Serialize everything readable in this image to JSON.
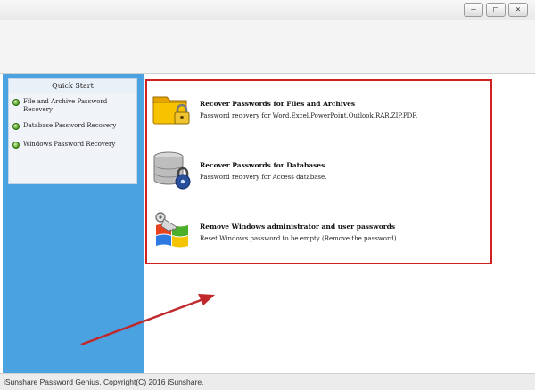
{
  "window": {
    "minimize_symbol": "–",
    "maximize_symbol": "□",
    "close_symbol": "×"
  },
  "sidebar": {
    "title": "Quick Start",
    "items": [
      {
        "label": "File and Archive Password Recovery",
        "icon": "green-bullet-icon"
      },
      {
        "label": "Database Password Recovery",
        "icon": "green-bullet-icon"
      },
      {
        "label": "Windows Password Recovery",
        "icon": "green-bullet-icon"
      }
    ]
  },
  "main": {
    "options": [
      {
        "title": "Recover Passwords for Files and Archives",
        "description": "Password recovery for Word,Excel,PowerPoint,Outlook,RAR,ZIP,PDF.",
        "icon": "locked-folder-icon"
      },
      {
        "title": "Recover Passwords for Databases",
        "description": "Password recovery for Access database.",
        "icon": "locked-database-icon"
      },
      {
        "title": "Remove Windows administrator and user passwords",
        "description": "Reset Windows password to be empty (Remove the password).",
        "icon": "windows-key-icon"
      }
    ]
  },
  "status": {
    "text": "iSunshare Password Genius. Copyright(C) 2016 iSunshare."
  },
  "colors": {
    "sidebar": "#4aa2e1",
    "highlight_frame": "#d02020",
    "arrow": "#c0282c"
  }
}
